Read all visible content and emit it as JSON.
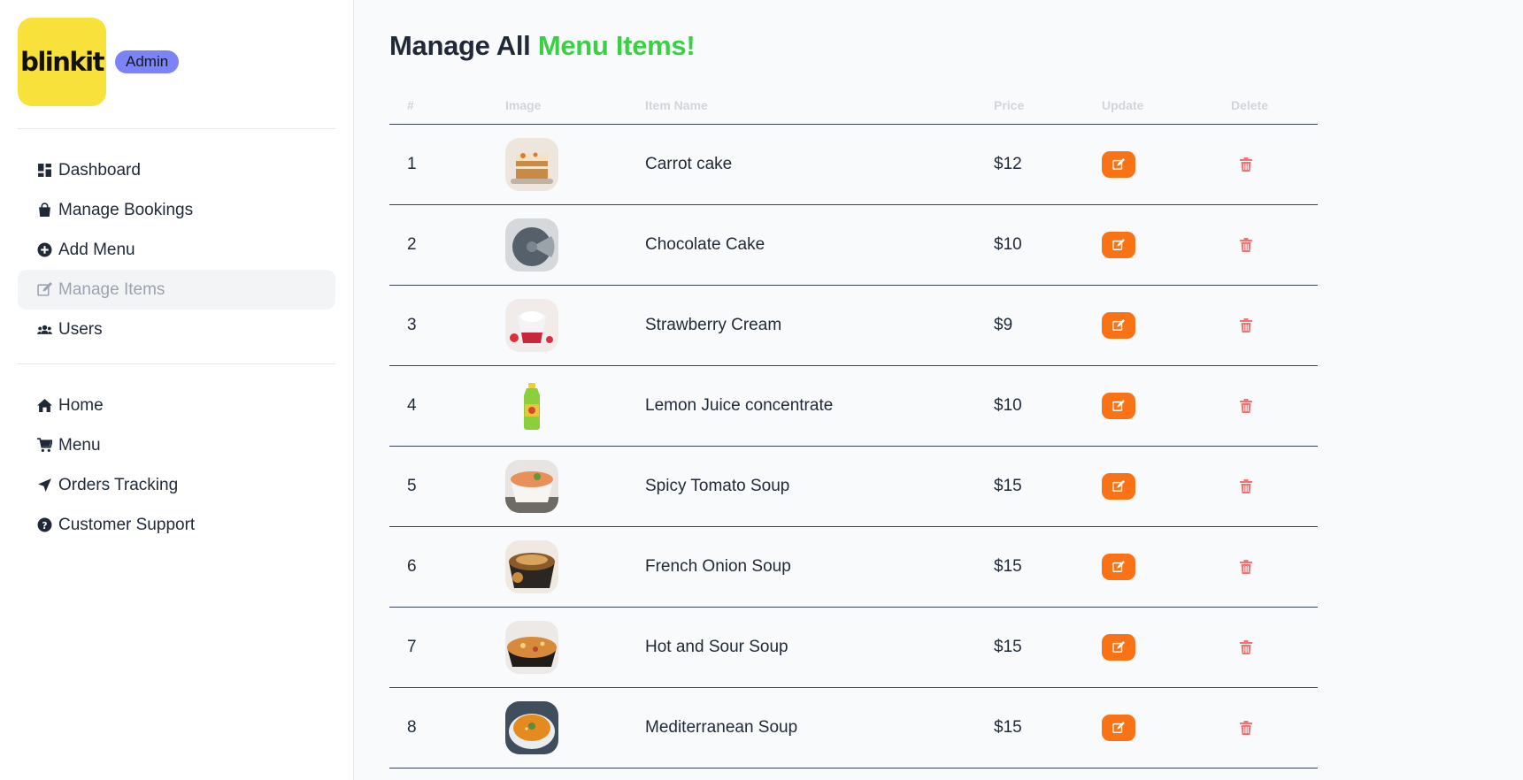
{
  "sidebar": {
    "logo_text": "blinkit",
    "role_badge": "Admin",
    "admin_links": [
      {
        "label": "Dashboard",
        "icon": "dashboard-icon"
      },
      {
        "label": "Manage Bookings",
        "icon": "shopping-bag-icon"
      },
      {
        "label": "Add Menu",
        "icon": "plus-circle-icon"
      },
      {
        "label": "Manage Items",
        "icon": "edit-icon",
        "active": true
      },
      {
        "label": "Users",
        "icon": "users-icon"
      }
    ],
    "site_links": [
      {
        "label": "Home",
        "icon": "home-icon"
      },
      {
        "label": "Menu",
        "icon": "cart-icon"
      },
      {
        "label": "Orders Tracking",
        "icon": "location-arrow-icon"
      },
      {
        "label": "Customer Support",
        "icon": "question-circle-icon"
      }
    ]
  },
  "main": {
    "title_prefix": "Manage All ",
    "title_accent": "Menu Items!",
    "table": {
      "headers": [
        "#",
        "Image",
        "Item Name",
        "Price",
        "Update",
        "Delete"
      ],
      "rows": [
        {
          "num": "1",
          "name": "Carrot cake",
          "price": "$12",
          "image": "carrot-cake-photo"
        },
        {
          "num": "2",
          "name": "Chocolate Cake",
          "price": "$10",
          "image": "chocolate-cake-photo"
        },
        {
          "num": "3",
          "name": "Strawberry Cream",
          "price": "$9",
          "image": "strawberry-cream-photo"
        },
        {
          "num": "4",
          "name": "Lemon Juice concentrate",
          "price": "$10",
          "image": "lemon-juice-bottle-photo"
        },
        {
          "num": "5",
          "name": "Spicy Tomato Soup",
          "price": "$15",
          "image": "tomato-soup-photo"
        },
        {
          "num": "6",
          "name": "French Onion Soup",
          "price": "$15",
          "image": "french-onion-soup-photo"
        },
        {
          "num": "7",
          "name": "Hot and Sour Soup",
          "price": "$15",
          "image": "hot-sour-soup-photo"
        },
        {
          "num": "8",
          "name": "Mediterranean Soup",
          "price": "$15",
          "image": "mediterranean-soup-photo"
        }
      ]
    }
  },
  "colors": {
    "accent_green": "#39d144",
    "update_orange": "#f97316",
    "delete_red": "#f87171",
    "badge_purple": "#7c83f6",
    "logo_yellow": "#f8e13a"
  }
}
